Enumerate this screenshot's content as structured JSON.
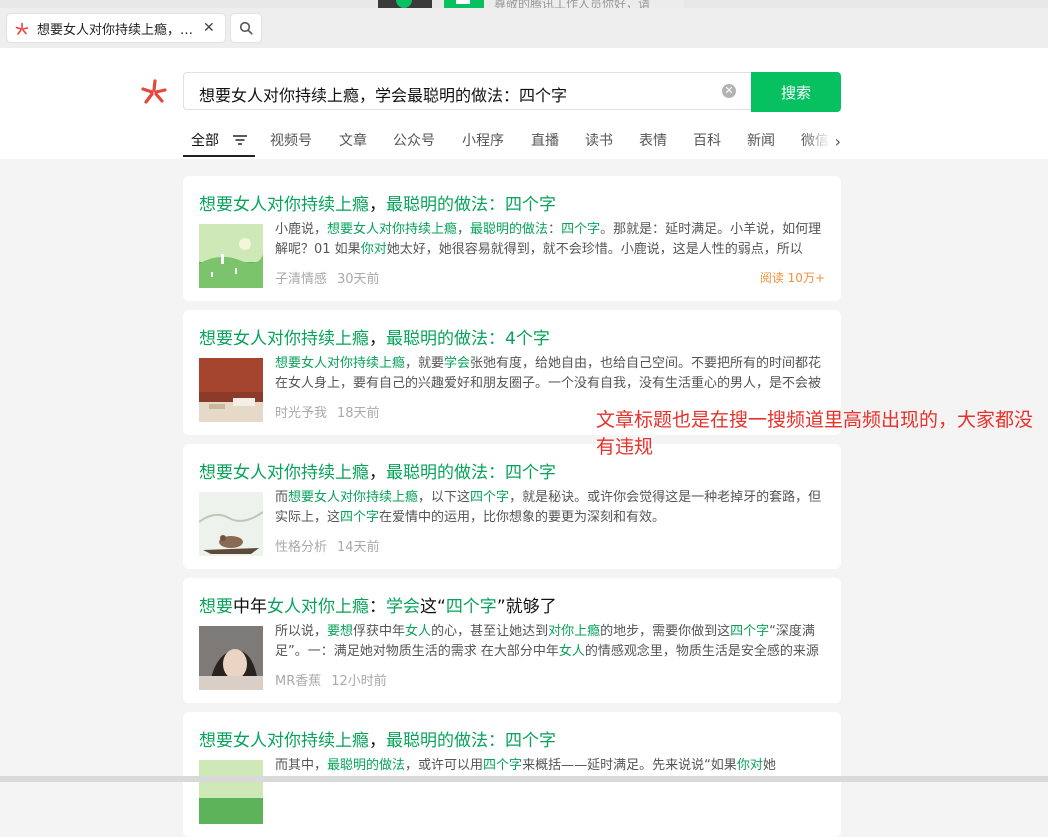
{
  "browser": {
    "tab_title": "想要女人对你持续上瘾，学会最聪明的做法：四个字",
    "top_notice": "尊敬的腾讯工作人员你好，请"
  },
  "search": {
    "query": "想要女人对你持续上瘾，学会最聪明的做法：四个字",
    "button": "搜索"
  },
  "nav": {
    "items": [
      "全部",
      "视频号",
      "文章",
      "公众号",
      "小程序",
      "直播",
      "读书",
      "表情",
      "百科",
      "新闻",
      "微信"
    ],
    "active": "全部"
  },
  "results": [
    {
      "title": [
        [
          "想要女人对你持续上瘾",
          true
        ],
        [
          "，",
          false
        ],
        [
          "最聪明的做法：四个字",
          true
        ]
      ],
      "desc": [
        [
          "小鹿说，",
          false
        ],
        [
          "想要女人对你持续上瘾",
          true
        ],
        [
          "，",
          false
        ],
        [
          "最聪明的做法",
          true
        ],
        [
          "：",
          false
        ],
        [
          "四个字",
          true
        ],
        [
          "。那就是：延时满足。小羊说，如何理解呢？01 如果",
          false
        ],
        [
          "你对",
          true
        ],
        [
          "她太好，她很容易就得到，就不会珍惜。小鹿说，这是人性的弱点，所以",
          false
        ]
      ],
      "source": "子清情感",
      "time": "30天前",
      "reads": "阅读 10万+"
    },
    {
      "title": [
        [
          "想要女人对你持续上瘾",
          true
        ],
        [
          "，",
          false
        ],
        [
          "最聪明的做法：4个字",
          true
        ]
      ],
      "desc": [
        [
          "想要女人对你持续上瘾",
          true
        ],
        [
          "，就要",
          false
        ],
        [
          "学会",
          true
        ],
        [
          "张弛有度，给她自由，也给自己空间。不要把所有的时间都花在女人身上，要有自己的兴趣爱好和朋友圈子。一个没有自我，没有生活重心的男人，是不会被珍惜的",
          false
        ]
      ],
      "source": "时光予我",
      "time": "18天前",
      "reads": ""
    },
    {
      "title": [
        [
          "想要女人对你持续上瘾",
          true
        ],
        [
          "，",
          false
        ],
        [
          "最聪明的做法：四个字",
          true
        ]
      ],
      "desc": [
        [
          "而",
          false
        ],
        [
          "想要女人对你持续上瘾",
          true
        ],
        [
          "，以下这",
          false
        ],
        [
          "四个字",
          true
        ],
        [
          "，就是秘诀。或许你会觉得这是一种老掉牙的套路，但实际上，这",
          false
        ],
        [
          "四个字",
          true
        ],
        [
          "在爱情中的运用，比你想象的要更为深刻和有效。",
          false
        ]
      ],
      "source": "性格分析",
      "time": "14天前",
      "reads": ""
    },
    {
      "title": [
        [
          "想要",
          true
        ],
        [
          "中年",
          false
        ],
        [
          "女人对你上瘾",
          true
        ],
        [
          "：",
          false
        ],
        [
          "学会",
          true
        ],
        [
          "这“",
          false
        ],
        [
          "四个字",
          true
        ],
        [
          "”就够了",
          false
        ]
      ],
      "desc": [
        [
          "所以说，",
          false
        ],
        [
          "要想",
          true
        ],
        [
          "俘获中年",
          false
        ],
        [
          "女人",
          true
        ],
        [
          "的心，甚至让她达到",
          false
        ],
        [
          "对你上瘾",
          true
        ],
        [
          "的地步，需要你做到这",
          false
        ],
        [
          "四个字",
          true
        ],
        [
          "“深度满足”。一：满足她对物质生活的需求 在大部分中年",
          false
        ],
        [
          "女人",
          true
        ],
        [
          "的情感观念里，物质生活是安全感的来源",
          false
        ]
      ],
      "source": "MR香蕉",
      "time": "12小时前",
      "reads": ""
    },
    {
      "title": [
        [
          "想要女人对你持续上瘾",
          true
        ],
        [
          "，",
          false
        ],
        [
          "最聪明的做法：四个字",
          true
        ]
      ],
      "desc": [
        [
          "而其中，",
          false
        ],
        [
          "最聪明的做法",
          true
        ],
        [
          "，或许可以用",
          false
        ],
        [
          "四个字",
          true
        ],
        [
          "来概括——延时满足。先来说说“如果",
          false
        ],
        [
          "你对",
          true
        ],
        [
          "她",
          false
        ]
      ],
      "source": "",
      "time": "",
      "reads": ""
    }
  ],
  "annotation": "文章标题也是在搜一搜频道里高频出现的，大家都没有违规",
  "colors": {
    "accent": "#07c160",
    "highlight": "#07a35a",
    "annotation": "#e8312b",
    "reads": "#f0913a"
  }
}
